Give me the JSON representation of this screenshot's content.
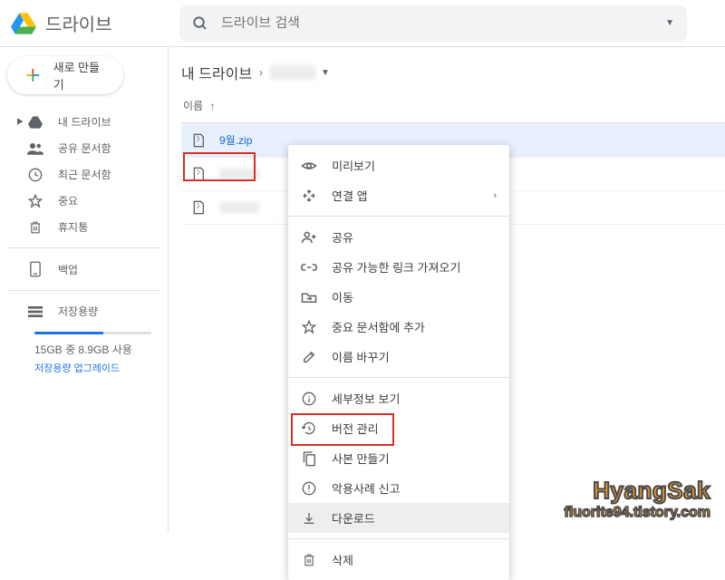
{
  "header": {
    "app_name": "드라이브",
    "search_placeholder": "드라이브 검색"
  },
  "sidebar": {
    "new_button": "새로 만들기",
    "items": [
      {
        "label": "내 드라이브",
        "icon": "drive"
      },
      {
        "label": "공유 문서함",
        "icon": "shared"
      },
      {
        "label": "최근 문서함",
        "icon": "recent"
      },
      {
        "label": "중요",
        "icon": "star"
      },
      {
        "label": "휴지통",
        "icon": "trash"
      }
    ],
    "backup_label": "백업",
    "storage_label": "저장용량",
    "storage_percent": 59,
    "storage_text": "15GB 중 8.9GB 사용",
    "storage_upgrade": "저장용량 업그레이드"
  },
  "breadcrumb": {
    "root": "내 드라이브"
  },
  "list": {
    "column_name": "이름",
    "files": [
      {
        "name": "9월.zip",
        "selected": true
      }
    ]
  },
  "context_menu": {
    "preview": "미리보기",
    "open_with": "연결 앱",
    "share": "공유",
    "get_link": "공유 가능한 링크 가져오기",
    "move": "이동",
    "add_star": "중요 문서함에 추가",
    "rename": "이름 바꾸기",
    "details": "세부정보 보기",
    "versions": "버전 관리",
    "copy": "사본 만들기",
    "report": "악용사례 신고",
    "download": "다운로드",
    "delete": "삭제"
  },
  "watermark": {
    "title": "HyangSak",
    "url": "fluorite94.tistory.com"
  }
}
